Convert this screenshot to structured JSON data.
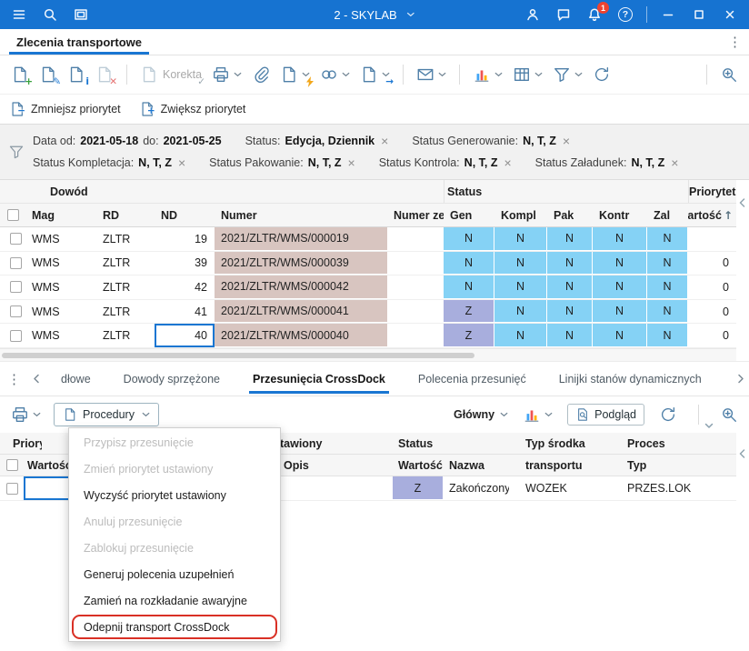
{
  "titlebar": {
    "title": "2 - SKYLAB",
    "notification_count": "1"
  },
  "page_tab": {
    "label": "Zlecenia transportowe"
  },
  "toolbar": {
    "korekta": "Korekta"
  },
  "priority_bar": {
    "decrease": "Zmniejsz priorytet",
    "increase": "Zwiększ priorytet"
  },
  "filters": [
    {
      "label": "Data od:",
      "value": "2021-05-18",
      "label2": "do:",
      "value2": "2021-05-25"
    },
    {
      "label": "Status:",
      "value": "Edycja, Dziennik"
    },
    {
      "label": "Status Generowanie:",
      "value": "N, T, Z"
    },
    {
      "label": "Status Kompletacja:",
      "value": "N, T, Z"
    },
    {
      "label": "Status Pakowanie:",
      "value": "N, T, Z"
    },
    {
      "label": "Status Kontrola:",
      "value": "N, T, Z"
    },
    {
      "label": "Status Załadunek:",
      "value": "N, T, Z"
    }
  ],
  "main_grid": {
    "groups": {
      "dowod": "Dowód",
      "status": "Status",
      "priorytet": "Priorytet"
    },
    "columns": {
      "mag": "Mag",
      "rd": "RD",
      "nd": "ND",
      "numer": "Numer",
      "numer_zew": "Numer zew.",
      "gen": "Gen",
      "kompl": "Kompl",
      "pak": "Pak",
      "kontr": "Kontr",
      "zal": "Zal",
      "wartosc": "Wartość"
    },
    "rows": [
      {
        "mag": "WMS",
        "rd": "ZLTR",
        "nd": "19",
        "numer": "2021/ZLTR/WMS/000019",
        "gen": "N",
        "kompl": "N",
        "pak": "N",
        "kontr": "N",
        "zal": "N",
        "wartosc": ""
      },
      {
        "mag": "WMS",
        "rd": "ZLTR",
        "nd": "39",
        "numer": "2021/ZLTR/WMS/000039",
        "gen": "N",
        "kompl": "N",
        "pak": "N",
        "kontr": "N",
        "zal": "N",
        "wartosc": "0"
      },
      {
        "mag": "WMS",
        "rd": "ZLTR",
        "nd": "42",
        "numer": "2021/ZLTR/WMS/000042",
        "gen": "N",
        "kompl": "N",
        "pak": "N",
        "kontr": "N",
        "zal": "N",
        "wartosc": "0"
      },
      {
        "mag": "WMS",
        "rd": "ZLTR",
        "nd": "41",
        "numer": "2021/ZLTR/WMS/000041",
        "gen": "Z",
        "kompl": "N",
        "pak": "N",
        "kontr": "N",
        "zal": "N",
        "wartosc": "0"
      },
      {
        "mag": "WMS",
        "rd": "ZLTR",
        "nd": "40",
        "numer": "2021/ZLTR/WMS/000040",
        "gen": "Z",
        "kompl": "N",
        "pak": "N",
        "kontr": "N",
        "zal": "N",
        "wartosc": "0"
      }
    ]
  },
  "bottom_tabs": {
    "items": [
      {
        "label": "dłowe",
        "active": false
      },
      {
        "label": "Dowody sprzężone",
        "active": false
      },
      {
        "label": "Przesunięcia CrossDock",
        "active": true
      },
      {
        "label": "Polecenia przesunięć",
        "active": false
      },
      {
        "label": "Linijki stanów dynamicznych",
        "active": false
      }
    ]
  },
  "bottom_toolbar": {
    "procedury": "Procedury",
    "glowny": "Główny",
    "podglad": "Podgląd"
  },
  "bottom_grid": {
    "groups": {
      "priorytet": "Priorytet",
      "ustawiony": "Ustawiony",
      "status": "Status",
      "typ_srodka": "Typ środka",
      "proces": "Proces"
    },
    "columns": {
      "wartosc_prio": "Wartość",
      "opis": "Opis",
      "wartosc": "Wartość",
      "nazwa": "Nazwa",
      "transportu": "transportu",
      "typ": "Typ"
    },
    "rows": [
      {
        "status_wartosc": "Z",
        "status_nazwa": "Zakończony",
        "typ_transportu": "WOZEK",
        "proces_typ": "PRZES.LOK"
      }
    ]
  },
  "menu": {
    "items": [
      {
        "label": "Przypisz przesunięcie",
        "disabled": true
      },
      {
        "label": "Zmień priorytet ustawiony",
        "disabled": true
      },
      {
        "label": "Wyczyść priorytet ustawiony",
        "disabled": false
      },
      {
        "label": "Anuluj przesunięcie",
        "disabled": true
      },
      {
        "label": "Zablokuj przesunięcie",
        "disabled": true
      },
      {
        "label": "Generuj polecenia uzupełnień",
        "disabled": false
      },
      {
        "label": "Zamień na rozkładanie awaryjne",
        "disabled": false
      },
      {
        "label": "Odepnij transport CrossDock",
        "disabled": false,
        "highlighted": true
      }
    ]
  },
  "icons": {
    "sort_asc": "↑",
    "close": "×",
    "more_vertical": "⋮",
    "help": "?",
    "add_badge": "+",
    "edit_badge": "✎",
    "info_badge": "i",
    "delete_badge": "✕",
    "korekta_badge": "✓",
    "minus_badge": "−",
    "plus_badge": "+",
    "arrow_badge": "→"
  }
}
